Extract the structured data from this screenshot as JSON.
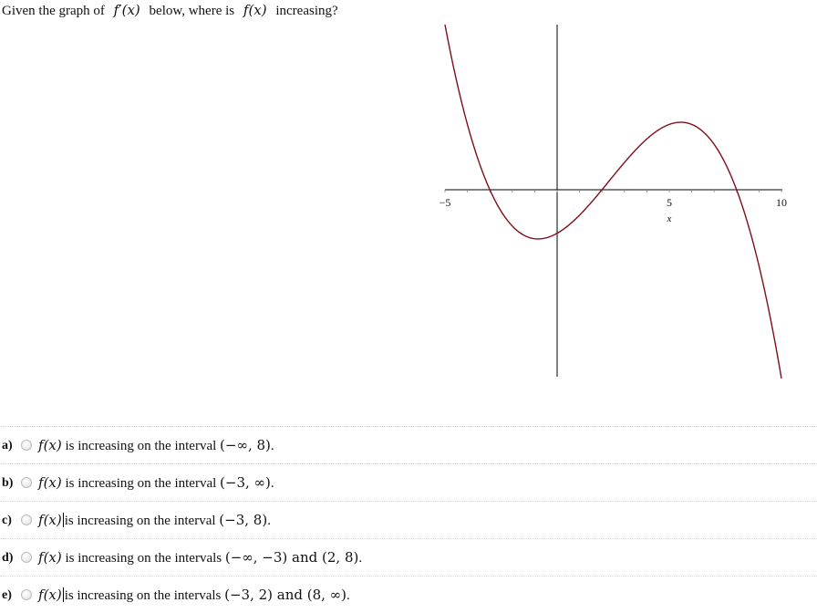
{
  "question": {
    "prefix": "Given the graph of",
    "derivative_expr_f": "f",
    "derivative_expr_prime": "′",
    "derivative_expr_arg": "(x)",
    "middle": "below, where is",
    "function_expr_f": "f",
    "function_expr_arg": "(x)",
    "suffix": "increasing?"
  },
  "chart_data": {
    "type": "line",
    "title": "",
    "xlabel": "x",
    "ylabel": "",
    "xlim": [
      -5,
      10
    ],
    "x_ticks": [
      -5,
      5,
      10
    ],
    "x_tick_labels": [
      "−5",
      "5",
      "10"
    ],
    "minor_tick_step": 1,
    "y_ticks": [],
    "grid": false,
    "legend": null,
    "curve_color": "#7f0f1a",
    "axis_color": "#000000",
    "series": [
      {
        "name": "f'(x)",
        "formula_roots": [
          -3,
          2,
          8
        ],
        "leading_sign": -1,
        "points": [
          {
            "x": -5,
            "y": 182
          },
          {
            "x": -3,
            "y": 0
          },
          {
            "x": -1,
            "y": -54
          },
          {
            "x": 0,
            "y": -48
          },
          {
            "x": 2,
            "y": 0
          },
          {
            "x": 5.5,
            "y": 74
          },
          {
            "x": 8,
            "y": 0
          },
          {
            "x": 10,
            "y": -208
          }
        ]
      }
    ],
    "ylim": [
      -208,
      182
    ]
  },
  "options": [
    {
      "letter": "a)",
      "pre": "is increasing on the interval",
      "intervals": "(−∞, 8)",
      "post": ".",
      "caret": false
    },
    {
      "letter": "b)",
      "pre": "is increasing on the interval",
      "intervals": "(−3, ∞)",
      "post": ".",
      "caret": false
    },
    {
      "letter": "c)",
      "pre": "is increasing on the interval",
      "intervals": "(−3, 8)",
      "post": ".",
      "caret": true
    },
    {
      "letter": "d)",
      "pre": "is increasing on the intervals",
      "intervals": "(−∞, −3) and (2, 8)",
      "post": ".",
      "caret": false
    },
    {
      "letter": "e)",
      "pre": "is increasing on the intervals",
      "intervals": "(−3, 2) and (8, ∞)",
      "post": ".",
      "caret": true
    }
  ],
  "option_function": {
    "f": "f",
    "arg": "(x)"
  }
}
